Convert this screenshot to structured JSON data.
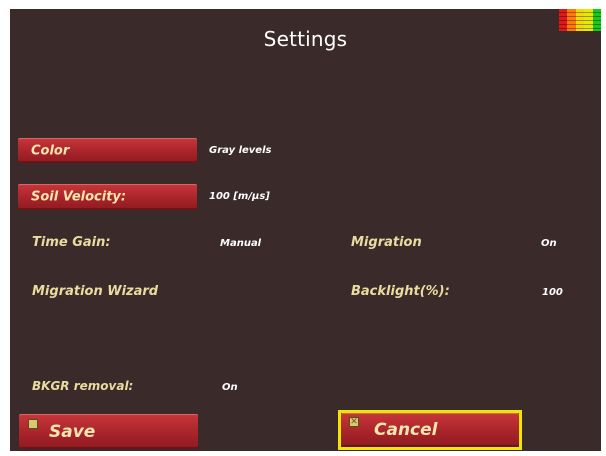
{
  "header": {
    "title": "Settings"
  },
  "level_meter": {
    "colors": [
      "#e01818",
      "#ff7a00",
      "#f5d800",
      "#e8e800",
      "#19c81e"
    ]
  },
  "settings": {
    "color": {
      "label": "Color",
      "value": "Gray levels"
    },
    "soil_velocity": {
      "label": "Soil Velocity:",
      "value": "100 [m/µs]"
    },
    "time_gain": {
      "label": "Time Gain:",
      "value": "Manual"
    },
    "migration": {
      "label": "Migration",
      "value": "On"
    },
    "migration_wizard": {
      "label": "Migration Wizard"
    },
    "backlight": {
      "label": "Backlight(%):",
      "value": "100"
    },
    "bkgr_removal": {
      "label": "BKGR removal:",
      "value": "On"
    }
  },
  "footer": {
    "save_label": "Save",
    "save_icon": "checkbox-icon",
    "cancel_label": "Cancel",
    "cancel_icon": "checkbox-x-icon",
    "cancel_checkbox_glyph": "✕"
  },
  "colors": {
    "background": "#3a2b2a",
    "button_red": "#b0282c",
    "label_yellow": "#e8dca0",
    "focus_yellow": "#f2e600"
  }
}
